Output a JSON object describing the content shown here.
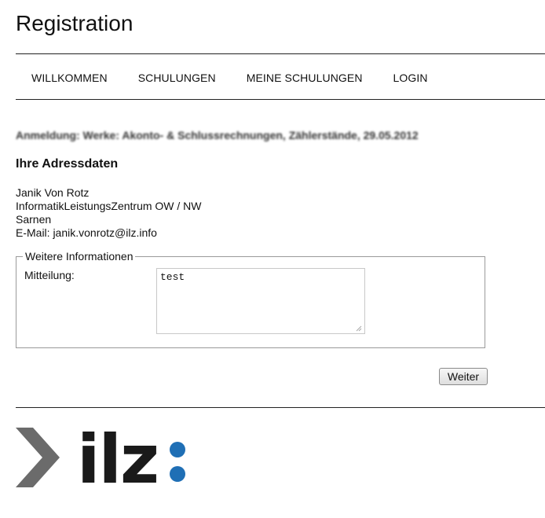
{
  "header": {
    "title": "Registration"
  },
  "nav": {
    "items": [
      {
        "label": "WILLKOMMEN"
      },
      {
        "label": "SCHULUNGEN"
      },
      {
        "label": "MEINE SCHULUNGEN"
      },
      {
        "label": "LOGIN"
      }
    ]
  },
  "main": {
    "event_title": "Anmeldung: Werke: Akonto- & Schlussrechnungen, Zählerstände, 29.05.2012",
    "address_heading": "Ihre Adressdaten",
    "address": {
      "name": "Janik Von Rotz",
      "organization": "InformatikLeistungsZentrum OW / NW",
      "city": "Sarnen",
      "email_line": "E-Mail: janik.vonrotz@ilz.info"
    },
    "fieldset": {
      "legend": "Weitere Informationen",
      "message_label": "Mitteilung:",
      "message_value": "test"
    },
    "submit_label": "Weiter"
  },
  "footer": {
    "logo_text": "ilz",
    "logo_colors": {
      "arrow": "#6b6b6b",
      "text": "#1a1a1a",
      "dots": "#1f6fb5"
    }
  }
}
